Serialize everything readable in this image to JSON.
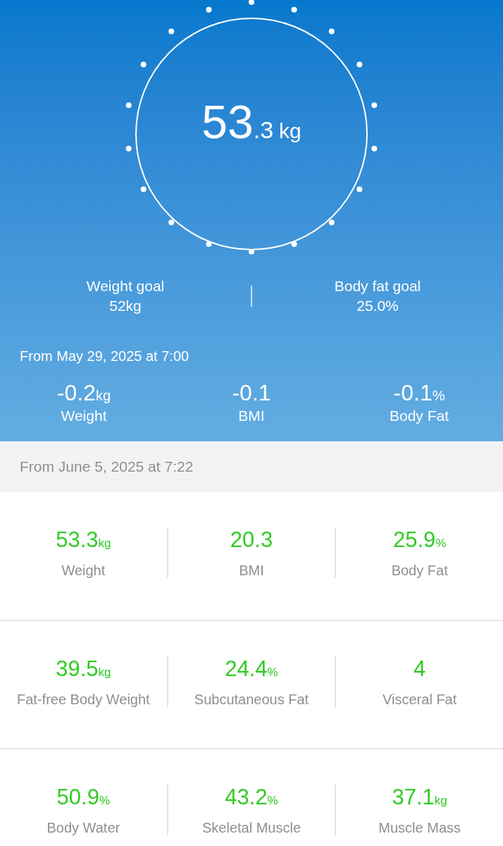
{
  "dial": {
    "value": "53",
    "decimal": ".3",
    "unit": "kg"
  },
  "goals": [
    {
      "label": "Weight goal",
      "value": "52kg"
    },
    {
      "label": "Body fat goal",
      "value": "25.0%"
    }
  ],
  "change": {
    "since": "From May 29, 2025 at 7:00",
    "items": [
      {
        "value": "-0.2",
        "unit": "kg",
        "label": "Weight"
      },
      {
        "value": "-0.1",
        "label": "BMI"
      },
      {
        "value": "-0.1",
        "unit": "%",
        "label": "Body Fat"
      }
    ]
  },
  "measurement": {
    "date": "From June 5, 2025 at 7:22",
    "rows": [
      [
        {
          "value": "53.3",
          "unit": "kg",
          "label": "Weight"
        },
        {
          "value": "20.3",
          "label": "BMI"
        },
        {
          "value": "25.9",
          "unit": "%",
          "label": "Body Fat"
        }
      ],
      [
        {
          "value": "39.5",
          "unit": "kg",
          "label": "Fat-free Body Weight"
        },
        {
          "value": "24.4",
          "unit": "%",
          "label": "Subcutaneous Fat"
        },
        {
          "value": "4",
          "label": "Visceral Fat"
        }
      ],
      [
        {
          "value": "50.9",
          "unit": "%",
          "label": "Body Water"
        },
        {
          "value": "43.2",
          "unit": "%",
          "label": "Skeletal Muscle"
        },
        {
          "value": "37.1",
          "unit": "kg",
          "label": "Muscle Mass"
        }
      ]
    ]
  }
}
